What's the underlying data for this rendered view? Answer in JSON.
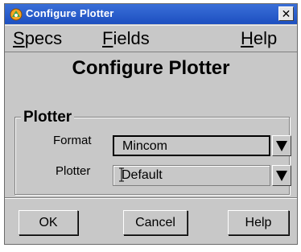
{
  "window": {
    "title": "Configure Plotter",
    "close_glyph": "✕"
  },
  "icons": {
    "app": "app-icon",
    "close": "close-icon",
    "dropdown": "dropdown-arrow-icon"
  },
  "menubar": {
    "specs": {
      "underline": "S",
      "rest": "pecs"
    },
    "fields": {
      "underline": "F",
      "rest": "ields"
    },
    "help": {
      "underline": "H",
      "rest": "elp"
    }
  },
  "heading": "Configure Plotter",
  "group": {
    "title": "Plotter",
    "format": {
      "label": "Format",
      "value": "Mincom"
    },
    "plotter": {
      "label": "Plotter",
      "value": "Default"
    }
  },
  "buttons": {
    "ok": "OK",
    "cancel": "Cancel",
    "help": "Help"
  },
  "colors": {
    "titlebar": "#1d4fc0",
    "surface": "#c8c8c8"
  }
}
